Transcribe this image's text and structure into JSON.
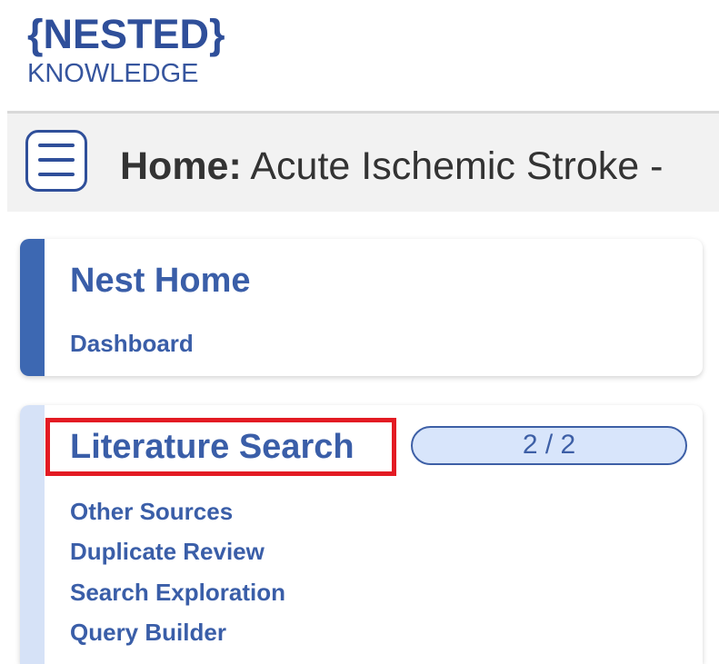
{
  "brand": {
    "logo_top": "{NESTED}",
    "logo_bottom": "KNOWLEDGE",
    "color": "#2f4f9a"
  },
  "header": {
    "menu_icon": "hamburger-menu-icon",
    "title_prefix": "Home:",
    "title_text": "Acute Ischemic Stroke -"
  },
  "nest_home": {
    "title": "Nest Home",
    "links": [
      "Dashboard"
    ],
    "accent_color": "#3d68b2"
  },
  "literature_search": {
    "title": "Literature Search",
    "progress_text": "2 / 2",
    "links": [
      "Other Sources",
      "Duplicate Review",
      "Search Exploration",
      "Query Builder"
    ],
    "accent_color": "#d6e2f7",
    "highlight_color": "#e31b23"
  }
}
